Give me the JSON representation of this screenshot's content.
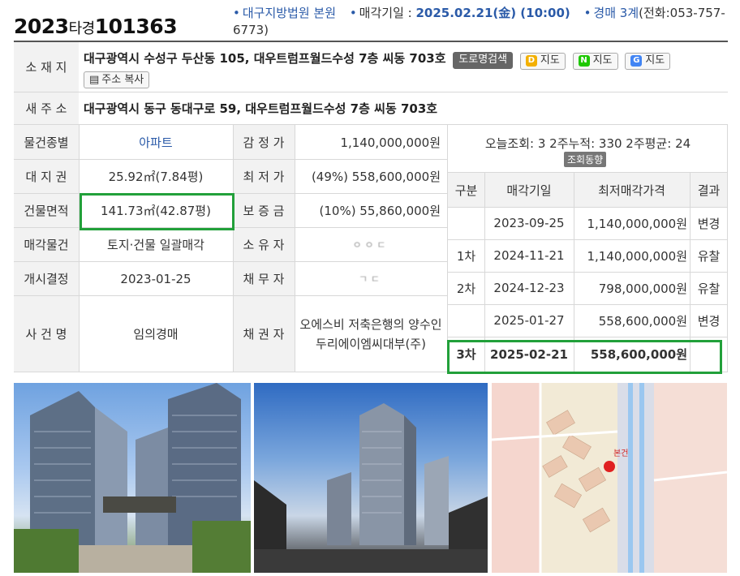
{
  "header": {
    "case_year": "2023",
    "case_type": "타경",
    "case_number": "101363",
    "court": "대구지방법원 본원",
    "sale_date_label": "매각기일 :",
    "sale_date": "2025.02.21(金) (10:00)",
    "dept": "경매 3계",
    "phone": "(전화:053-757-6773)"
  },
  "address": {
    "label": "소 재 지",
    "value": "대구광역시 수성구 두산동 105, 대우트럼프월드수성 7층 씨동 703호",
    "road_search_btn": "도로명검색",
    "map1": "지도",
    "map2": "지도",
    "map3": "지도",
    "copy_btn": "주소 복사"
  },
  "new_address": {
    "label": "새 주 소",
    "value": "대구광역시 동구 동대구로 59, 대우트럼프월드수성 7층 씨동 703호"
  },
  "details": {
    "kind_label": "물건종별",
    "kind_value": "아파트",
    "appraisal_label": "감 정 가",
    "appraisal_value": "1,140,000,000원",
    "land_label": "대 지 권",
    "land_value": "25.92㎡(7.84평)",
    "min_label": "최 저 가",
    "min_value": "(49%) 558,600,000원",
    "building_label": "건물면적",
    "building_value": "141.73㎡(42.87평)",
    "deposit_label": "보 증 금",
    "deposit_value": "(10%) 55,860,000원",
    "sale_type_label": "매각물건",
    "sale_type_value": "토지·건물 일괄매각",
    "owner_label": "소 유 자",
    "owner_value": "ㅇ ㅇ ㄷ",
    "start_label": "개시결정",
    "start_value": "2023-01-25",
    "debtor_label": "채 무 자",
    "debtor_value": "ㄱ ㄷ",
    "case_name_label": "사 건 명",
    "case_name_value": "임의경매",
    "creditor_label": "채 권 자",
    "creditor_value": "오에스비 저축은행의 양수인 두리에이엠씨대부(주)"
  },
  "stats": {
    "text": "오늘조회: 3  2주누적: 330  2주평균: 24",
    "button": "조회동향"
  },
  "history": {
    "headers": [
      "구분",
      "매각기일",
      "최저매각가격",
      "결과"
    ],
    "rows": [
      {
        "round": "",
        "date": "2023-09-25",
        "price": "1,140,000,000원",
        "result": "변경"
      },
      {
        "round": "1차",
        "date": "2024-11-21",
        "price": "1,140,000,000원",
        "result": "유찰"
      },
      {
        "round": "2차",
        "date": "2024-12-23",
        "price": "798,000,000원",
        "result": "유찰"
      },
      {
        "round": "",
        "date": "2025-01-27",
        "price": "558,600,000원",
        "result": "변경"
      },
      {
        "round": "3차",
        "date": "2025-02-21",
        "price": "558,600,000원",
        "result": ""
      }
    ]
  },
  "photos": {
    "map_label": "본건"
  },
  "colors": {
    "accent_blue": "#2a5aa8",
    "highlight_green": "#22a03a",
    "label_bg": "#f2f2f2"
  }
}
